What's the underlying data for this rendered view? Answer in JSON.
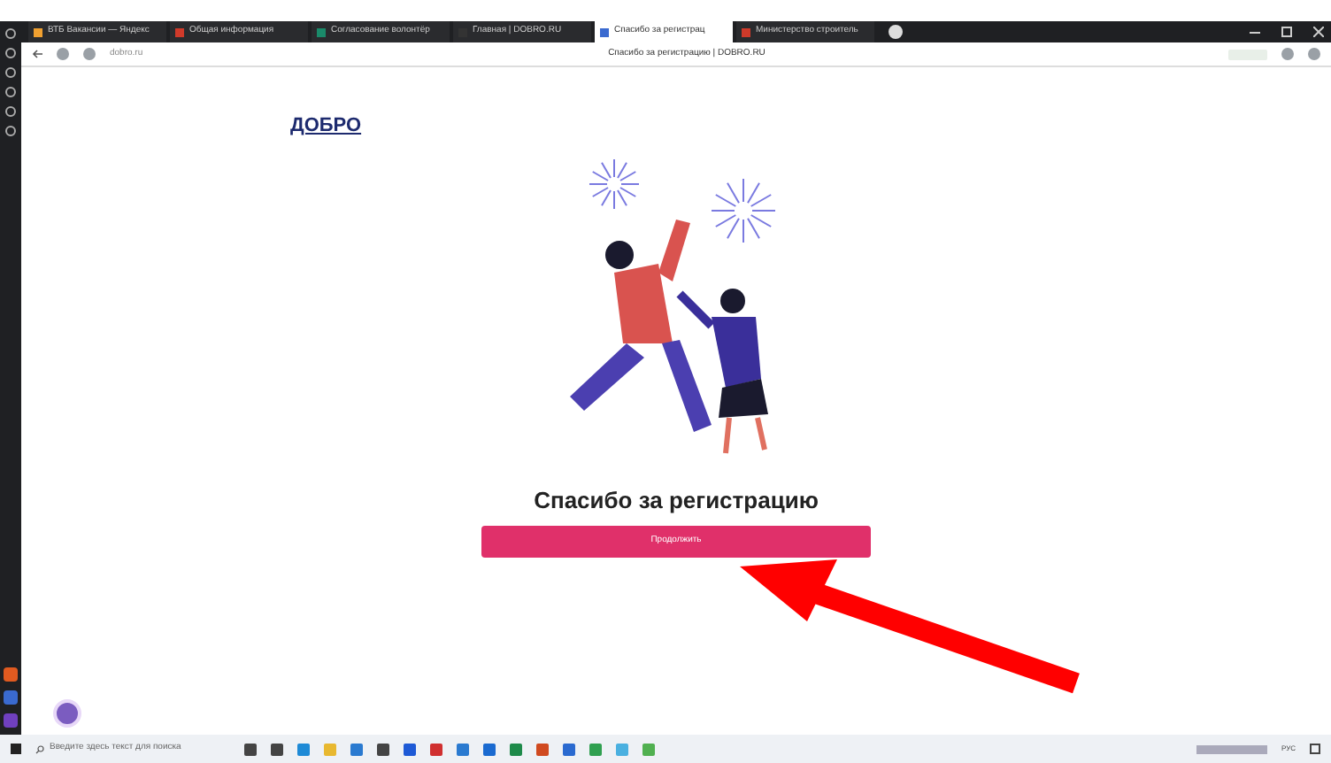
{
  "browser": {
    "tabs": [
      {
        "title": "ВТБ Вакансии — Яндекс",
        "selected": false,
        "color": "#f0a030"
      },
      {
        "title": "Общая информация",
        "selected": false,
        "color": "#d03a2a"
      },
      {
        "title": "Согласование волонтёр",
        "selected": false,
        "color": "#1a8a6a"
      },
      {
        "title": "Главная | DOBRO.RU",
        "selected": false,
        "color": "#333333"
      },
      {
        "title": "Спасибо за регистрац",
        "selected": true,
        "color": "#3a6ad0"
      },
      {
        "title": "Министерство строитель",
        "selected": false,
        "color": "#d03a2a"
      }
    ],
    "address": "dobro.ru",
    "page_title": "Спасибо за регистрацию | DOBRO.RU"
  },
  "page": {
    "logo": "ДОБРО",
    "heading": "Спасибо за регистрацию",
    "button": "Продолжить"
  },
  "taskbar": {
    "search_placeholder": "Введите здесь текст для поиска",
    "language": "РУС"
  }
}
